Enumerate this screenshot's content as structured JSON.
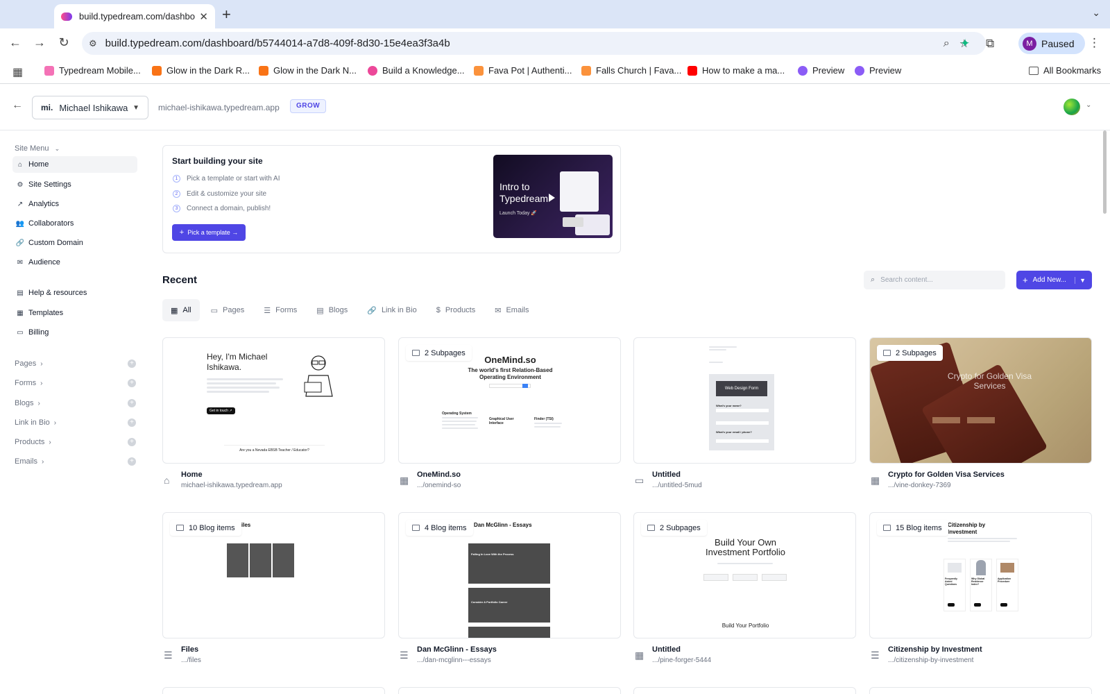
{
  "browser": {
    "tab_title": "build.typedream.com/dashbo",
    "url": "build.typedream.com/dashboard/b5744014-a7d8-409f-8d30-15e4ea3f3a4b",
    "profile_initial": "M",
    "profile_label": "Paused",
    "bookmarks": [
      {
        "label": "Typedream Mobile...",
        "icon": "avatar-icon",
        "color": "#f472b6"
      },
      {
        "label": "Glow in the Dark R...",
        "icon": "e-icon",
        "color": "#f97316"
      },
      {
        "label": "Glow in the Dark N...",
        "icon": "e-icon",
        "color": "#f97316"
      },
      {
        "label": "Build a Knowledge...",
        "icon": "typedream-icon",
        "color": "#ec4899"
      },
      {
        "label": "Fava Pot | Authenti...",
        "icon": "fava-icon",
        "color": "#fb923c"
      },
      {
        "label": "Falls Church | Fava...",
        "icon": "fava-icon",
        "color": "#fb923c"
      },
      {
        "label": "How to make a ma...",
        "icon": "youtube-icon",
        "color": "#ff0000"
      },
      {
        "label": "Preview",
        "icon": "typedream-icon",
        "color": "#8b5cf6"
      },
      {
        "label": "Preview",
        "icon": "typedream-icon",
        "color": "#8b5cf6"
      }
    ],
    "all_bookmarks": "All Bookmarks"
  },
  "header": {
    "site_name": "Michael Ishikawa",
    "site_logo": "mi.",
    "domain": "michael-ishikawa.typedream.app",
    "plan": "GROW"
  },
  "sidebar": {
    "menu_title": "Site Menu",
    "items": [
      {
        "label": "Home",
        "icon": "⌂"
      },
      {
        "label": "Site Settings",
        "icon": "⚙"
      },
      {
        "label": "Analytics",
        "icon": "↗"
      },
      {
        "label": "Collaborators",
        "icon": "👥"
      },
      {
        "label": "Custom Domain",
        "icon": "🔗"
      },
      {
        "label": "Audience",
        "icon": "✉"
      }
    ],
    "secondary": [
      {
        "label": "Help & resources",
        "icon": "▤"
      },
      {
        "label": "Templates",
        "icon": "▦"
      },
      {
        "label": "Billing",
        "icon": "▭"
      }
    ],
    "groups": [
      "Pages",
      "Forms",
      "Blogs",
      "Link in Bio",
      "Products",
      "Emails"
    ]
  },
  "onboarding": {
    "title": "Start building your site",
    "steps": [
      "Pick a template or start with AI",
      "Edit & customize your site",
      "Connect a domain, publish!"
    ],
    "button": "Pick a template →",
    "video_title": "Intro to Typedream",
    "video_sub": "Launch Today 🚀"
  },
  "recent": {
    "title": "Recent",
    "search_placeholder": "Search content...",
    "add_new": "Add New...",
    "filters": [
      "All",
      "Pages",
      "Forms",
      "Blogs",
      "Link in Bio",
      "Products",
      "Emails"
    ],
    "cards": [
      {
        "title": "Home",
        "path": "michael-ishikawa.typedream.app",
        "badge": ""
      },
      {
        "title": "OneMind.so",
        "path": ".../onemind-so",
        "badge": "2 Subpages"
      },
      {
        "title": "Untitled",
        "path": ".../untitled-5mud",
        "badge": ""
      },
      {
        "title": "Crypto for Golden Visa Services",
        "path": ".../vine-donkey-7369",
        "badge": "2 Subpages"
      },
      {
        "title": "Files",
        "path": ".../files",
        "badge": "10 Blog items"
      },
      {
        "title": "Dan McGlinn - Essays",
        "path": ".../dan-mcglinn---essays",
        "badge": "4 Blog items"
      },
      {
        "title": "Untitled",
        "path": ".../pine-forger-5444",
        "badge": "2 Subpages"
      },
      {
        "title": "Citizenship by Investment",
        "path": ".../citizenship-by-investment",
        "badge": "15 Blog items"
      }
    ],
    "thumb_text": {
      "home_heading": "Hey, I'm Michael Ishikawa.",
      "home_btn": "Get in touch ↗",
      "home_banner": "Are you a Nevada EBSB Teacher / Educator?",
      "onemind_title": "OneMind.so",
      "onemind_sub": "The world's first Relation-Based Operating Environment",
      "onemind_col1": "Operating System",
      "onemind_col2": "Graphical User Interface",
      "onemind_col3": "Finder (TSI)",
      "untitled_form": "Web Design Form",
      "untitled_q1": "What's your name?",
      "untitled_q2": "What's your email / phone?",
      "crypto_title": "Crypto for Golden Visa Services",
      "files_tag": "Files",
      "dan_tag": "Dan McGlinn - Essays",
      "dan_post1": "Falling In Love With the Process",
      "dan_post2": "Consider A Portfolio Career",
      "invest_title": "Build Your Own Investment Portfolio",
      "invest_foot": "Build Your Portfolio",
      "cbi_tag": "Citizenship by Investment",
      "cbi_c1": "Frequently Asked Questions",
      "cbi_c2": "Why Global Residence Index?",
      "cbi_c3": "Application Procedure"
    }
  }
}
